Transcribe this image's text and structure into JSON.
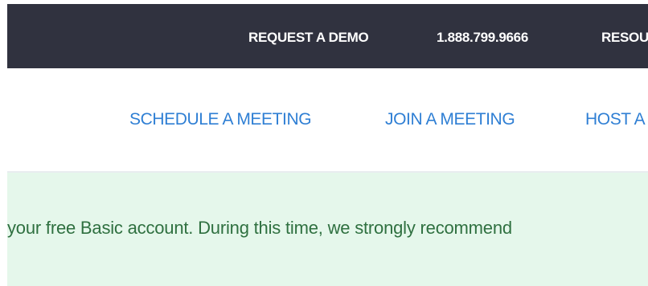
{
  "top_bar": {
    "links": {
      "request_demo": "REQUEST A DEMO",
      "phone": "1.888.799.9666",
      "resources": "RESOU"
    },
    "background_color": "#30323f",
    "text_color": "#ffffff"
  },
  "main_nav": {
    "links": {
      "schedule": "SCHEDULE A MEETING",
      "join": "JOIN A MEETING",
      "host": "HOST A"
    },
    "link_color": "#2f7fd4"
  },
  "notice": {
    "text": "your free Basic account. During this time, we strongly recommend",
    "background_color": "#e5f7eb",
    "text_color": "#2f7040"
  }
}
